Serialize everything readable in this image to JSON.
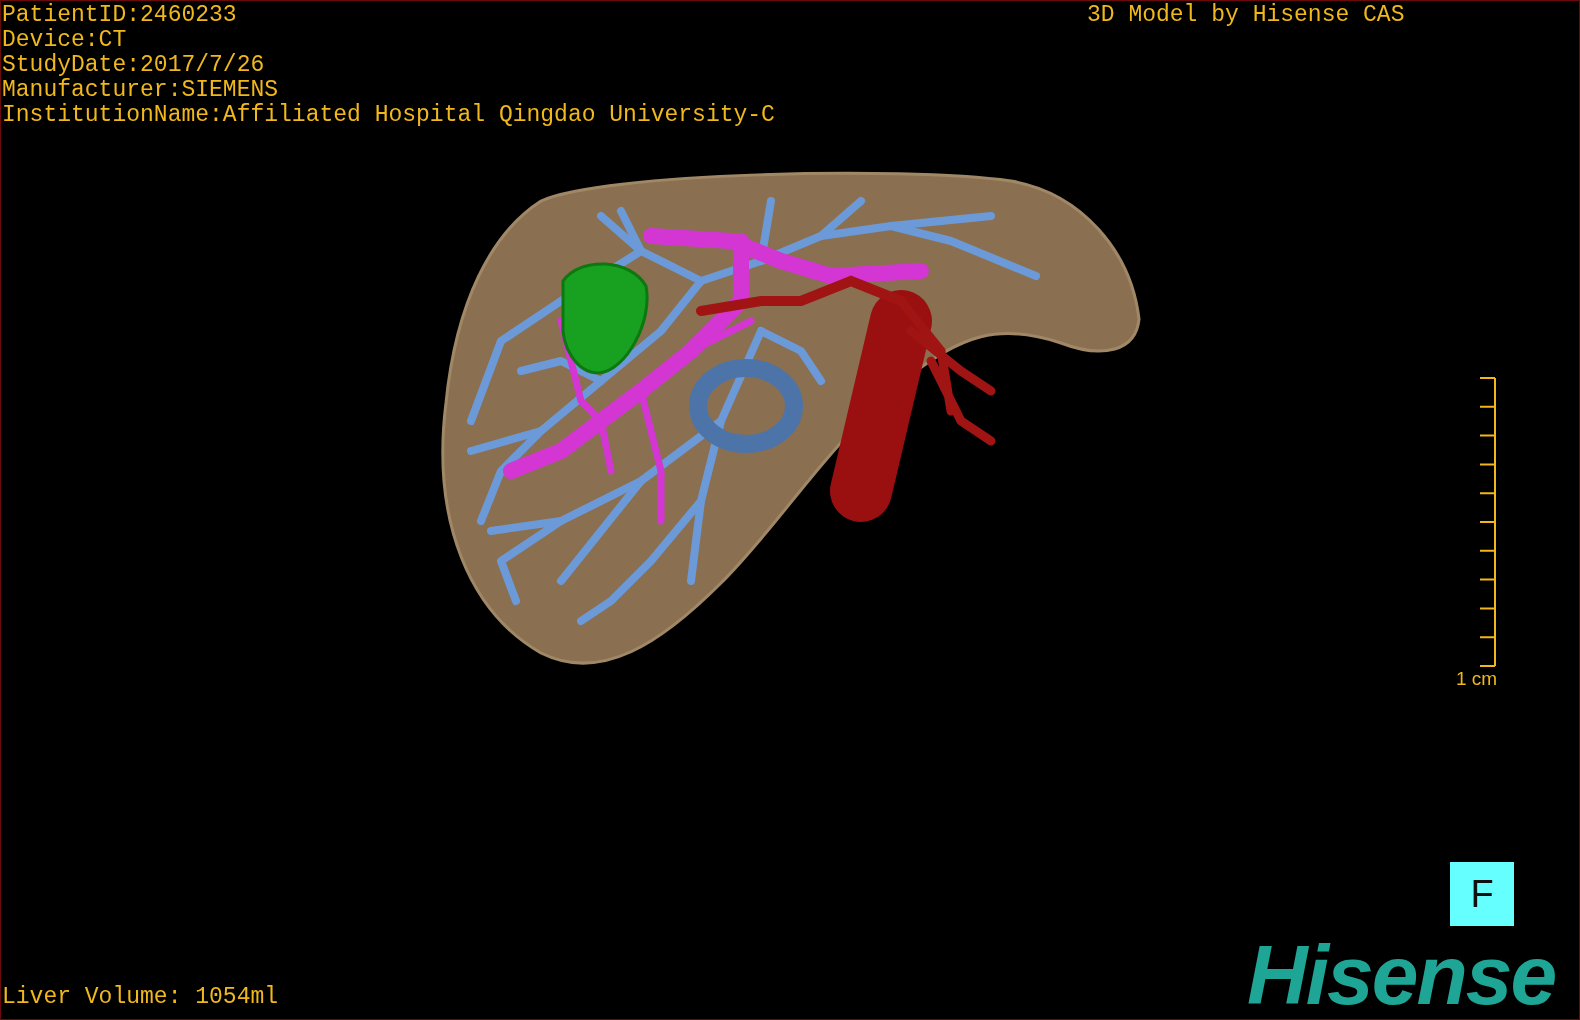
{
  "info_lines": [
    "PatientID:2460233",
    "Device:CT",
    "StudyDate:2017/7/26",
    "Manufacturer:SIEMENS",
    "InstitutionName:Affiliated Hospital Qingdao University-C"
  ],
  "title": "3D Model by Hisense CAS",
  "scale_bar": {
    "label": "1 cm"
  },
  "orientation_marker": "F",
  "liver_volume": "Liver Volume: 1054ml",
  "logo": "Hisense"
}
